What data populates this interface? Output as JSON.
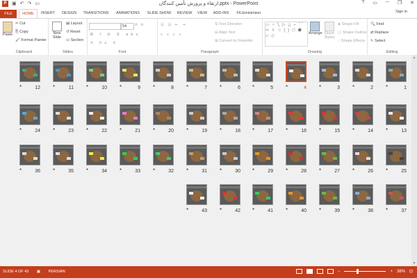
{
  "window": {
    "title": "ارتقاء و پرورش تأمین کنندگان.pptx - PowerPoint",
    "controls": [
      "?",
      "▭",
      "─",
      "❐",
      "✕"
    ]
  },
  "tabs": [
    "FILE",
    "HOME",
    "INSERT",
    "DESIGN",
    "TRANSITIONS",
    "ANIMATIONS",
    "SLIDE SHOW",
    "REVIEW",
    "VIEW",
    "ADD-INS",
    "FILEminimizer"
  ],
  "active_tab": "HOME",
  "account": {
    "signin": "Sign in"
  },
  "ribbon": {
    "clipboard": {
      "label": "Clipboard",
      "paste": "Paste",
      "cut": "Cut",
      "copy": "Copy",
      "format_painter": "Format Painter"
    },
    "slides": {
      "label": "Slides",
      "new_slide": "New Slide",
      "layout": "Layout",
      "reset": "Reset",
      "section": "Section"
    },
    "font": {
      "label": "Font",
      "size": "54"
    },
    "paragraph": {
      "label": "Paragraph",
      "text_direction": "Text Direction",
      "align_text": "Align Text",
      "convert": "Convert to SmartArt"
    },
    "drawing": {
      "label": "Drawing",
      "arrange": "Arrange",
      "quick_styles": "Quick Styles",
      "shape_fill": "Shape Fill",
      "shape_outline": "Shape Outline",
      "shape_effects": "Shape Effects"
    },
    "editing": {
      "label": "Editing",
      "find": "Find",
      "replace": "Replace",
      "select": "Select"
    }
  },
  "slides": {
    "selected": 4,
    "items": [
      {
        "n": "1",
        "c": "#8ab"
      },
      {
        "n": "2",
        "c": "#cde"
      },
      {
        "n": "3",
        "c": "#9bd"
      },
      {
        "n": "4",
        "c": "#eee"
      },
      {
        "n": "5",
        "c": "#ddd"
      },
      {
        "n": "6",
        "c": "#bbb"
      },
      {
        "n": "7",
        "c": "#cb8"
      },
      {
        "n": "8",
        "c": "#ccc"
      },
      {
        "n": "9",
        "c": "#de6"
      },
      {
        "n": "10",
        "c": "#7c9"
      },
      {
        "n": "11",
        "c": "#49c"
      },
      {
        "n": "12",
        "c": "#4a8"
      },
      {
        "n": "13",
        "c": "#eee"
      },
      {
        "n": "14",
        "c": "#c44"
      },
      {
        "n": "15",
        "c": "#d33"
      },
      {
        "n": "16",
        "c": "#e33"
      },
      {
        "n": "17",
        "c": "#c88"
      },
      {
        "n": "18",
        "c": "#aaa"
      },
      {
        "n": "19",
        "c": "#ccc"
      },
      {
        "n": "20",
        "c": "#a86"
      },
      {
        "n": "21",
        "c": "#e7c"
      },
      {
        "n": "22",
        "c": "#eee"
      },
      {
        "n": "23",
        "c": "#ddd"
      },
      {
        "n": "24",
        "c": "#5ad"
      },
      {
        "n": "25",
        "c": "#444"
      },
      {
        "n": "26",
        "c": "#ddd"
      },
      {
        "n": "27",
        "c": "#6b4"
      },
      {
        "n": "28",
        "c": "#c33"
      },
      {
        "n": "29",
        "c": "#d92"
      },
      {
        "n": "30",
        "c": "#bcd"
      },
      {
        "n": "31",
        "c": "#c96"
      },
      {
        "n": "32",
        "c": "#4c6"
      },
      {
        "n": "33",
        "c": "#3c5"
      },
      {
        "n": "34",
        "c": "#ee4"
      },
      {
        "n": "35",
        "c": "#dde"
      },
      {
        "n": "36",
        "c": "#ddc"
      },
      {
        "n": "37",
        "c": "#c55"
      },
      {
        "n": "38",
        "c": "#8ad"
      },
      {
        "n": "39",
        "c": "#6b4"
      },
      {
        "n": "40",
        "c": "#d93"
      },
      {
        "n": "41",
        "c": "#3c6"
      },
      {
        "n": "42",
        "c": "#d33"
      },
      {
        "n": "43",
        "c": "#eee"
      }
    ]
  },
  "status": {
    "slide_of": "SLIDE 4 OF 43",
    "language": "PERSIAN",
    "zoom": "38%",
    "minus": "−",
    "plus": "+"
  },
  "colors": {
    "accent": "#c43e1c",
    "selection": "#d24726"
  }
}
